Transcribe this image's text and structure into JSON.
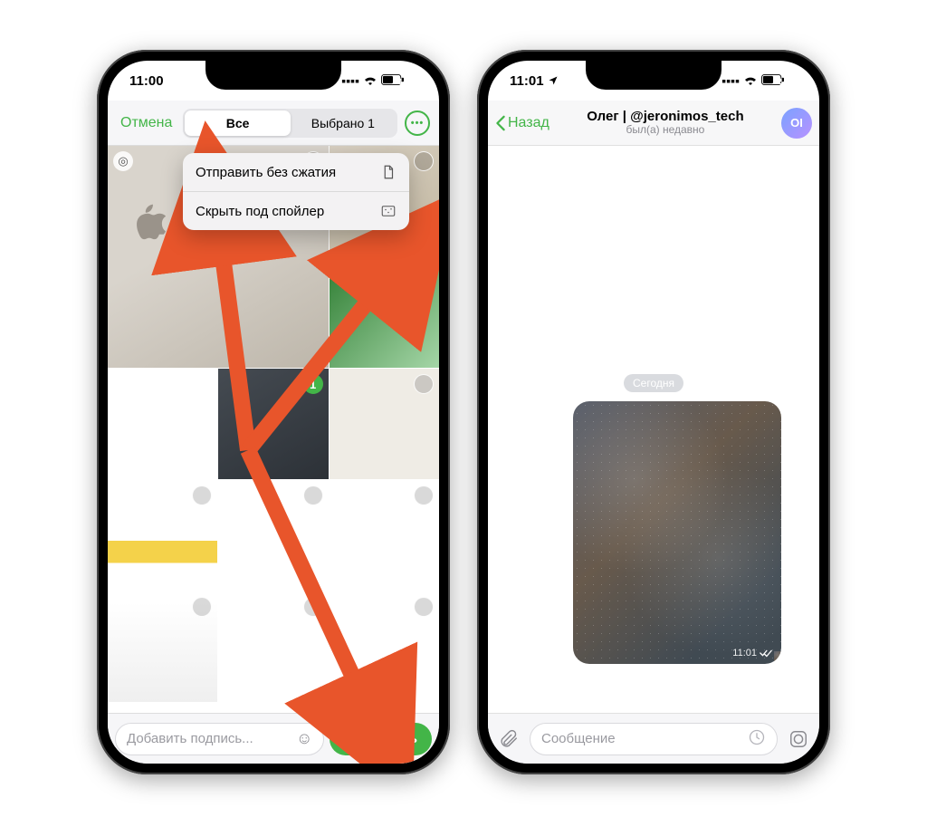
{
  "accent_color": "#43b548",
  "left": {
    "status": {
      "time": "11:00",
      "battery": "53"
    },
    "header": {
      "cancel": "Отмена",
      "seg_all": "Все",
      "seg_selected": "Выбрано 1"
    },
    "menu": {
      "send_uncompressed": "Отправить без сжатия",
      "hide_spoiler": "Скрыть под спойлер"
    },
    "selected_badge": "1",
    "caption_placeholder": "Добавить подпись...",
    "send": "Отправить"
  },
  "right": {
    "status": {
      "time": "11:01",
      "battery": "52"
    },
    "header": {
      "back": "Назад",
      "title": "Олег | @jeronimos_tech",
      "subtitle": "был(а) недавно",
      "avatar_initials": "OI"
    },
    "date": "Сегодня",
    "msg_time": "11:01",
    "input_placeholder": "Сообщение"
  }
}
